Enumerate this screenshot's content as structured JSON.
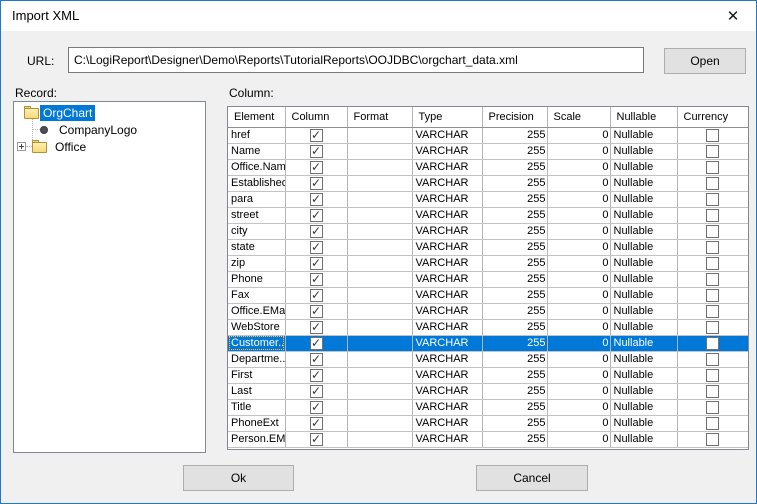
{
  "window": {
    "title": "Import XML"
  },
  "url_bar": {
    "label": "URL:",
    "value": "C:\\LogiReport\\Designer\\Demo\\Reports\\TutorialReports\\OOJDBC\\orgchart_data.xml",
    "open_label": "Open"
  },
  "record_panel": {
    "label": "Record:",
    "tree": [
      {
        "label": "OrgChart",
        "icon": "folder",
        "selected": true
      },
      {
        "label": "CompanyLogo",
        "icon": "bullet",
        "selected": false
      },
      {
        "label": "Office",
        "icon": "folder",
        "expandable": true,
        "selected": false
      }
    ]
  },
  "column_panel": {
    "label": "Column:",
    "headers": [
      "Element",
      "Column",
      "Format",
      "Type",
      "Precision",
      "Scale",
      "Nullable",
      "Currency"
    ],
    "rows": [
      {
        "element": "href",
        "column_checked": true,
        "format": "",
        "type": "VARCHAR",
        "precision": "255",
        "scale": "0",
        "nullable": "Nullable",
        "currency_checked": false,
        "selected": false
      },
      {
        "element": "Name",
        "column_checked": true,
        "format": "",
        "type": "VARCHAR",
        "precision": "255",
        "scale": "0",
        "nullable": "Nullable",
        "currency_checked": false,
        "selected": false
      },
      {
        "element": "Office.Name",
        "column_checked": true,
        "format": "",
        "type": "VARCHAR",
        "precision": "255",
        "scale": "0",
        "nullable": "Nullable",
        "currency_checked": false,
        "selected": false
      },
      {
        "element": "Established",
        "column_checked": true,
        "format": "",
        "type": "VARCHAR",
        "precision": "255",
        "scale": "0",
        "nullable": "Nullable",
        "currency_checked": false,
        "selected": false
      },
      {
        "element": "para",
        "column_checked": true,
        "format": "",
        "type": "VARCHAR",
        "precision": "255",
        "scale": "0",
        "nullable": "Nullable",
        "currency_checked": false,
        "selected": false
      },
      {
        "element": "street",
        "column_checked": true,
        "format": "",
        "type": "VARCHAR",
        "precision": "255",
        "scale": "0",
        "nullable": "Nullable",
        "currency_checked": false,
        "selected": false
      },
      {
        "element": "city",
        "column_checked": true,
        "format": "",
        "type": "VARCHAR",
        "precision": "255",
        "scale": "0",
        "nullable": "Nullable",
        "currency_checked": false,
        "selected": false
      },
      {
        "element": "state",
        "column_checked": true,
        "format": "",
        "type": "VARCHAR",
        "precision": "255",
        "scale": "0",
        "nullable": "Nullable",
        "currency_checked": false,
        "selected": false
      },
      {
        "element": "zip",
        "column_checked": true,
        "format": "",
        "type": "VARCHAR",
        "precision": "255",
        "scale": "0",
        "nullable": "Nullable",
        "currency_checked": false,
        "selected": false
      },
      {
        "element": "Phone",
        "column_checked": true,
        "format": "",
        "type": "VARCHAR",
        "precision": "255",
        "scale": "0",
        "nullable": "Nullable",
        "currency_checked": false,
        "selected": false
      },
      {
        "element": "Fax",
        "column_checked": true,
        "format": "",
        "type": "VARCHAR",
        "precision": "255",
        "scale": "0",
        "nullable": "Nullable",
        "currency_checked": false,
        "selected": false
      },
      {
        "element": "Office.EMail",
        "column_checked": true,
        "format": "",
        "type": "VARCHAR",
        "precision": "255",
        "scale": "0",
        "nullable": "Nullable",
        "currency_checked": false,
        "selected": false
      },
      {
        "element": "WebStore",
        "column_checked": true,
        "format": "",
        "type": "VARCHAR",
        "precision": "255",
        "scale": "0",
        "nullable": "Nullable",
        "currency_checked": false,
        "selected": false
      },
      {
        "element": "Customer...",
        "column_checked": true,
        "format": "",
        "type": "VARCHAR",
        "precision": "255",
        "scale": "0",
        "nullable": "Nullable",
        "currency_checked": false,
        "selected": true
      },
      {
        "element": "Departme...",
        "column_checked": true,
        "format": "",
        "type": "VARCHAR",
        "precision": "255",
        "scale": "0",
        "nullable": "Nullable",
        "currency_checked": false,
        "selected": false
      },
      {
        "element": "First",
        "column_checked": true,
        "format": "",
        "type": "VARCHAR",
        "precision": "255",
        "scale": "0",
        "nullable": "Nullable",
        "currency_checked": false,
        "selected": false
      },
      {
        "element": "Last",
        "column_checked": true,
        "format": "",
        "type": "VARCHAR",
        "precision": "255",
        "scale": "0",
        "nullable": "Nullable",
        "currency_checked": false,
        "selected": false
      },
      {
        "element": "Title",
        "column_checked": true,
        "format": "",
        "type": "VARCHAR",
        "precision": "255",
        "scale": "0",
        "nullable": "Nullable",
        "currency_checked": false,
        "selected": false
      },
      {
        "element": "PhoneExt",
        "column_checked": true,
        "format": "",
        "type": "VARCHAR",
        "precision": "255",
        "scale": "0",
        "nullable": "Nullable",
        "currency_checked": false,
        "selected": false
      },
      {
        "element": "Person.EMail",
        "column_checked": true,
        "format": "",
        "type": "VARCHAR",
        "precision": "255",
        "scale": "0",
        "nullable": "Nullable",
        "currency_checked": false,
        "selected": false
      }
    ]
  },
  "buttons": {
    "ok": "Ok",
    "cancel": "Cancel"
  },
  "colors": {
    "selection": "#0078d7",
    "dialog_border": "#2079c8",
    "titlebar": "#ffffff",
    "body": "#f0f0f0"
  }
}
